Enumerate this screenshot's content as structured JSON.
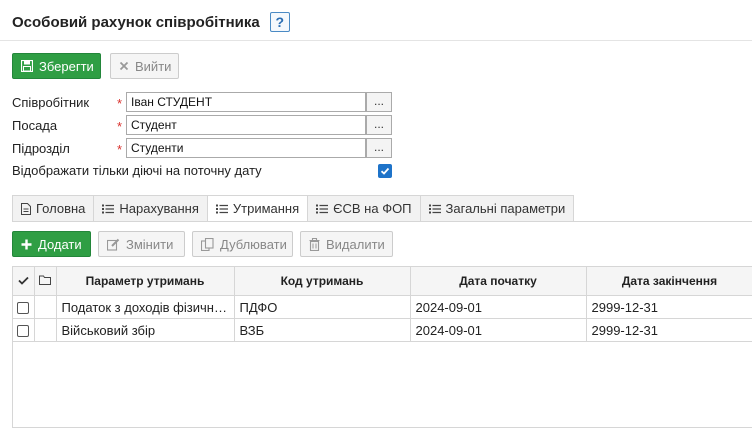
{
  "header": {
    "title": "Особовий рахунок співробітника",
    "help": "?"
  },
  "toolbar": {
    "save_label": "Зберегти",
    "exit_label": "Вийти"
  },
  "form": {
    "employee_label": "Співробітник",
    "employee_value": "Іван СТУДЕНТ",
    "position_label": "Посада",
    "position_value": "Студент",
    "department_label": "Підрозділ",
    "department_value": "Студенти",
    "required_mark": "*",
    "browse_label": "...",
    "show_current_label": "Відображати тільки діючі на поточну дату",
    "show_current_checked": true
  },
  "tabs": [
    {
      "label": "Головна",
      "icon": "document-icon"
    },
    {
      "label": "Нарахування",
      "icon": "list-icon"
    },
    {
      "label": "Утримання",
      "icon": "list-icon",
      "active": true
    },
    {
      "label": "ЄСВ на ФОП",
      "icon": "list-icon"
    },
    {
      "label": "Загальні параметри",
      "icon": "list-icon"
    }
  ],
  "actions": {
    "add": "Додати",
    "edit": "Змінити",
    "duplicate": "Дублювати",
    "delete": "Видалити"
  },
  "table": {
    "columns": [
      "Параметр утримань",
      "Код утримань",
      "Дата початку",
      "Дата закінчення"
    ],
    "rows": [
      [
        "Податок з доходів фізичних осіб",
        "ПДФО",
        "2024-09-01",
        "2999-12-31"
      ],
      [
        "Військовий збір",
        "ВЗБ",
        "2024-09-01",
        "2999-12-31"
      ]
    ]
  },
  "colors": {
    "accent_green": "#2f9e44",
    "checkbox_blue": "#1e73c9",
    "required_red": "#d9302c"
  }
}
